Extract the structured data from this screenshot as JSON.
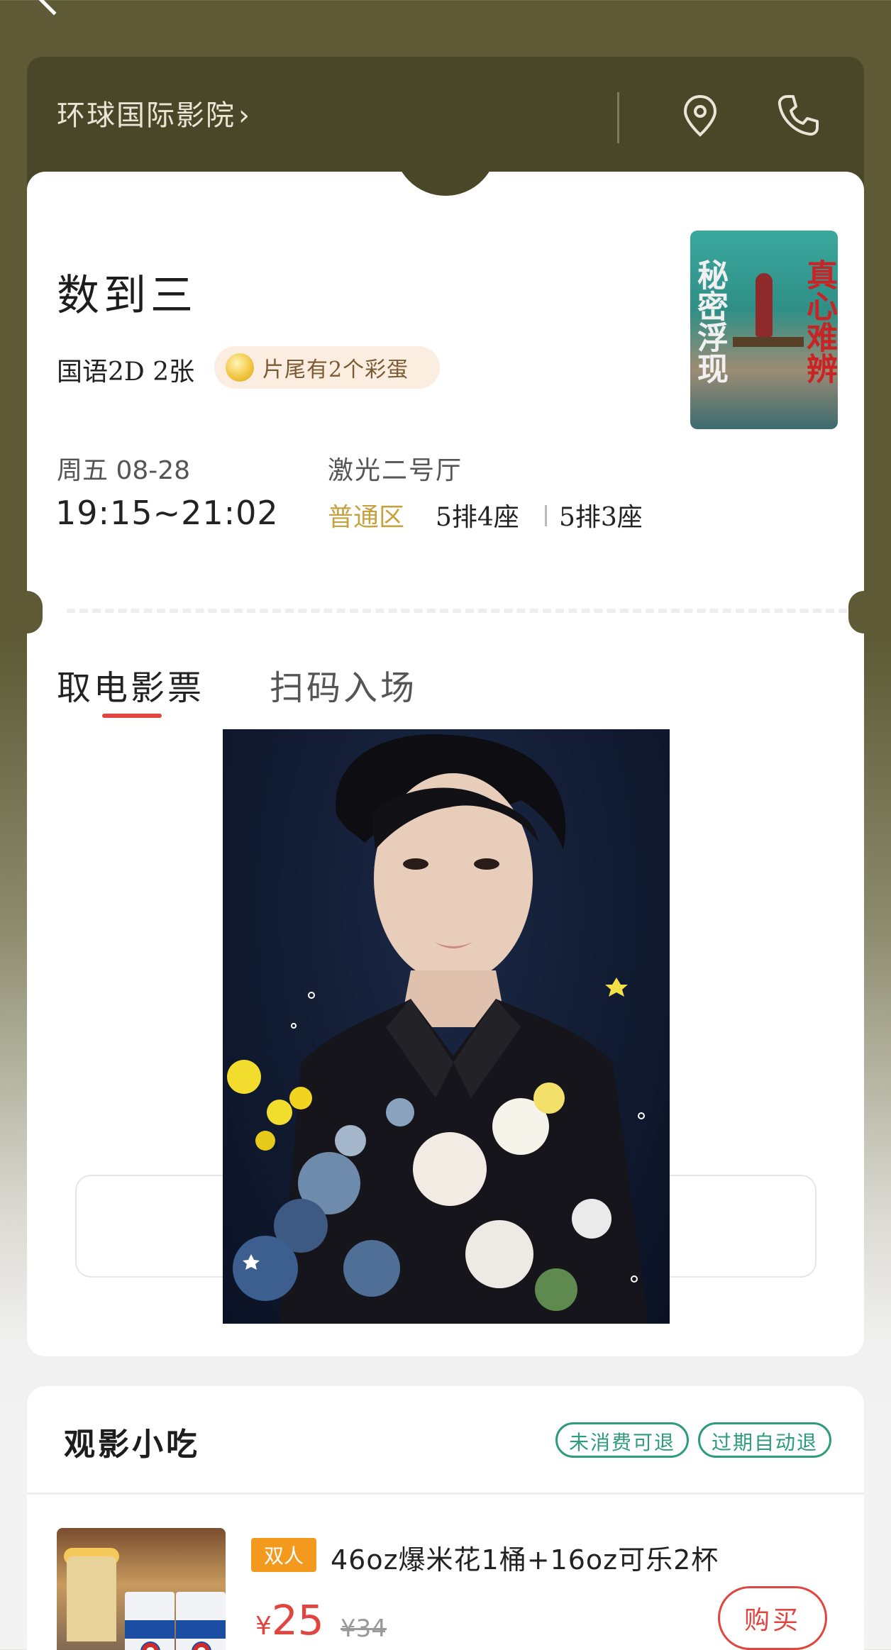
{
  "header": {
    "cinema_name": "环球国际影院",
    "cinema_chevron": "›",
    "location_icon": "location-pin-icon",
    "phone_icon": "phone-icon"
  },
  "ticket": {
    "movie_title": "数到三",
    "format": "国语2D 2张",
    "easter_egg_note": "片尾有2个彩蛋",
    "poster": {
      "left_text": "秘密浮现",
      "right_text": "真心难辨"
    },
    "date": "周五 08-28",
    "time_range": "19:15~21:02",
    "hall": "激光二号厅",
    "seat_zone": "普通区",
    "seats": [
      "5排4座",
      "5排3座"
    ],
    "tabs": [
      "取电影票",
      "扫码入场"
    ],
    "active_tab_index": 0
  },
  "snacks": {
    "title": "观影小吃",
    "tags": [
      "未消费可退",
      "过期自动退"
    ],
    "item": {
      "badge": "双人",
      "name": "46oz爆米花1桶+16oz可乐2杯",
      "currency": "¥",
      "price": "25",
      "original_price": "¥34",
      "buy_label": "购买"
    }
  },
  "colors": {
    "brand_olive": "#5d5a35",
    "accent_red": "#e0453f",
    "policy_green": "#2e9b7a",
    "zone_gold": "#c6a23f",
    "badge_orange": "#f39a1e"
  }
}
